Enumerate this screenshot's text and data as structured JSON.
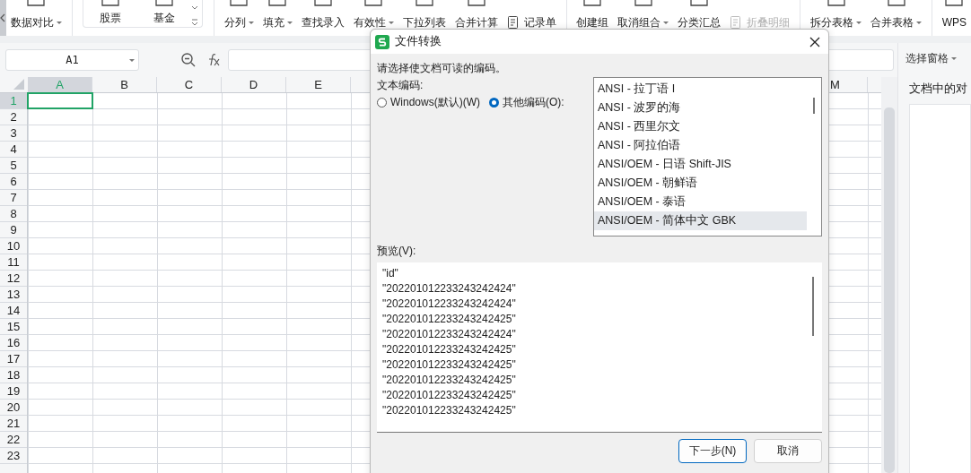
{
  "ribbon": {
    "groups": [
      {
        "items": [
          {
            "label": "数据对比",
            "dropdown": true,
            "disabled": false,
            "kind": "top"
          }
        ]
      },
      {
        "boxed": true,
        "items": [
          {
            "label": "股票",
            "dropdown": false,
            "disabled": false,
            "kind": "top"
          },
          {
            "label": "基金",
            "dropdown": false,
            "disabled": false,
            "kind": "top"
          }
        ]
      },
      {
        "items": [
          {
            "label": "分列",
            "dropdown": true,
            "disabled": false,
            "kind": "top"
          },
          {
            "label": "填充",
            "dropdown": true,
            "disabled": false,
            "kind": "top"
          },
          {
            "label": "查找录入",
            "dropdown": false,
            "disabled": false,
            "kind": "top"
          },
          {
            "label": "有效性",
            "dropdown": true,
            "disabled": false,
            "kind": "top"
          },
          {
            "label": "下拉列表",
            "dropdown": false,
            "disabled": false,
            "kind": "top"
          },
          {
            "label": "合并计算",
            "dropdown": false,
            "disabled": false,
            "kind": "top"
          },
          {
            "label": "记录单",
            "dropdown": false,
            "disabled": false,
            "kind": "inline"
          }
        ]
      },
      {
        "items": [
          {
            "label": "创建组",
            "dropdown": false,
            "disabled": false,
            "kind": "top"
          },
          {
            "label": "取消组合",
            "dropdown": true,
            "disabled": false,
            "kind": "top"
          },
          {
            "label": "分类汇总",
            "dropdown": false,
            "disabled": false,
            "kind": "top"
          },
          {
            "label": "折叠明细",
            "dropdown": false,
            "disabled": true,
            "kind": "inline"
          }
        ]
      },
      {
        "items": [
          {
            "label": "拆分表格",
            "dropdown": true,
            "disabled": false,
            "kind": "top"
          },
          {
            "label": "合并表格",
            "dropdown": true,
            "disabled": false,
            "kind": "top"
          }
        ]
      },
      {
        "items": [
          {
            "label": "WPS",
            "dropdown": false,
            "disabled": false,
            "kind": "top"
          }
        ]
      }
    ]
  },
  "formula_bar": {
    "cell_name": "A1"
  },
  "sheet": {
    "columns_left": [
      {
        "label": "A",
        "selected": true
      },
      {
        "label": "B",
        "selected": false
      },
      {
        "label": "C",
        "selected": false
      },
      {
        "label": "D",
        "selected": false
      },
      {
        "label": "E",
        "selected": false
      }
    ],
    "columns_right": [
      {
        "label": "M",
        "selected": false
      }
    ],
    "rows": [
      {
        "label": "1",
        "selected": true
      },
      {
        "label": "2",
        "selected": false
      },
      {
        "label": "3",
        "selected": false
      },
      {
        "label": "4",
        "selected": false
      },
      {
        "label": "5",
        "selected": false
      },
      {
        "label": "6",
        "selected": false
      },
      {
        "label": "7",
        "selected": false
      },
      {
        "label": "8",
        "selected": false
      },
      {
        "label": "9",
        "selected": false
      },
      {
        "label": "10",
        "selected": false
      },
      {
        "label": "11",
        "selected": false
      },
      {
        "label": "12",
        "selected": false
      },
      {
        "label": "13",
        "selected": false
      },
      {
        "label": "14",
        "selected": false
      },
      {
        "label": "15",
        "selected": false
      },
      {
        "label": "16",
        "selected": false
      },
      {
        "label": "17",
        "selected": false
      },
      {
        "label": "18",
        "selected": false
      },
      {
        "label": "19",
        "selected": false
      },
      {
        "label": "20",
        "selected": false
      },
      {
        "label": "21",
        "selected": false
      },
      {
        "label": "22",
        "selected": false
      },
      {
        "label": "23",
        "selected": false
      }
    ]
  },
  "side_pane": {
    "title": "选择窗格",
    "heading": "文档中的对"
  },
  "dialog": {
    "title": "文件转换",
    "prompt": "请选择使文档可读的编码。",
    "encoding_label": "文本编码:",
    "radios": [
      {
        "label": "Windows(默认)(W)",
        "selected": false
      },
      {
        "label": "其他编码(O):",
        "selected": true
      }
    ],
    "encodings": [
      {
        "label": "ANSI - 拉丁语 I",
        "selected": false
      },
      {
        "label": "ANSI - 波罗的海",
        "selected": false
      },
      {
        "label": "ANSI - 西里尔文",
        "selected": false
      },
      {
        "label": "ANSI - 阿拉伯语",
        "selected": false
      },
      {
        "label": "ANSI/OEM - 日语 Shift-JIS",
        "selected": false
      },
      {
        "label": "ANSI/OEM - 朝鲜语",
        "selected": false
      },
      {
        "label": "ANSI/OEM - 泰语",
        "selected": false
      },
      {
        "label": "ANSI/OEM - 简体中文 GBK",
        "selected": true
      }
    ],
    "preview_label": "预览(V):",
    "preview_lines": [
      "\"id\"",
      "\"202201012233243242424\"",
      "\"202201012233243242424\"",
      "\"202201012233243242425\"",
      "\"202201012233243242424\"",
      "\"202201012233243242425\"",
      "\"202201012233243242425\"",
      "\"202201012233243242425\"",
      "\"202201012233243242425\"",
      "\"202201012233243242425\""
    ],
    "buttons": [
      {
        "label": "下一步(N)",
        "default": true
      },
      {
        "label": "取消",
        "default": false
      }
    ]
  }
}
